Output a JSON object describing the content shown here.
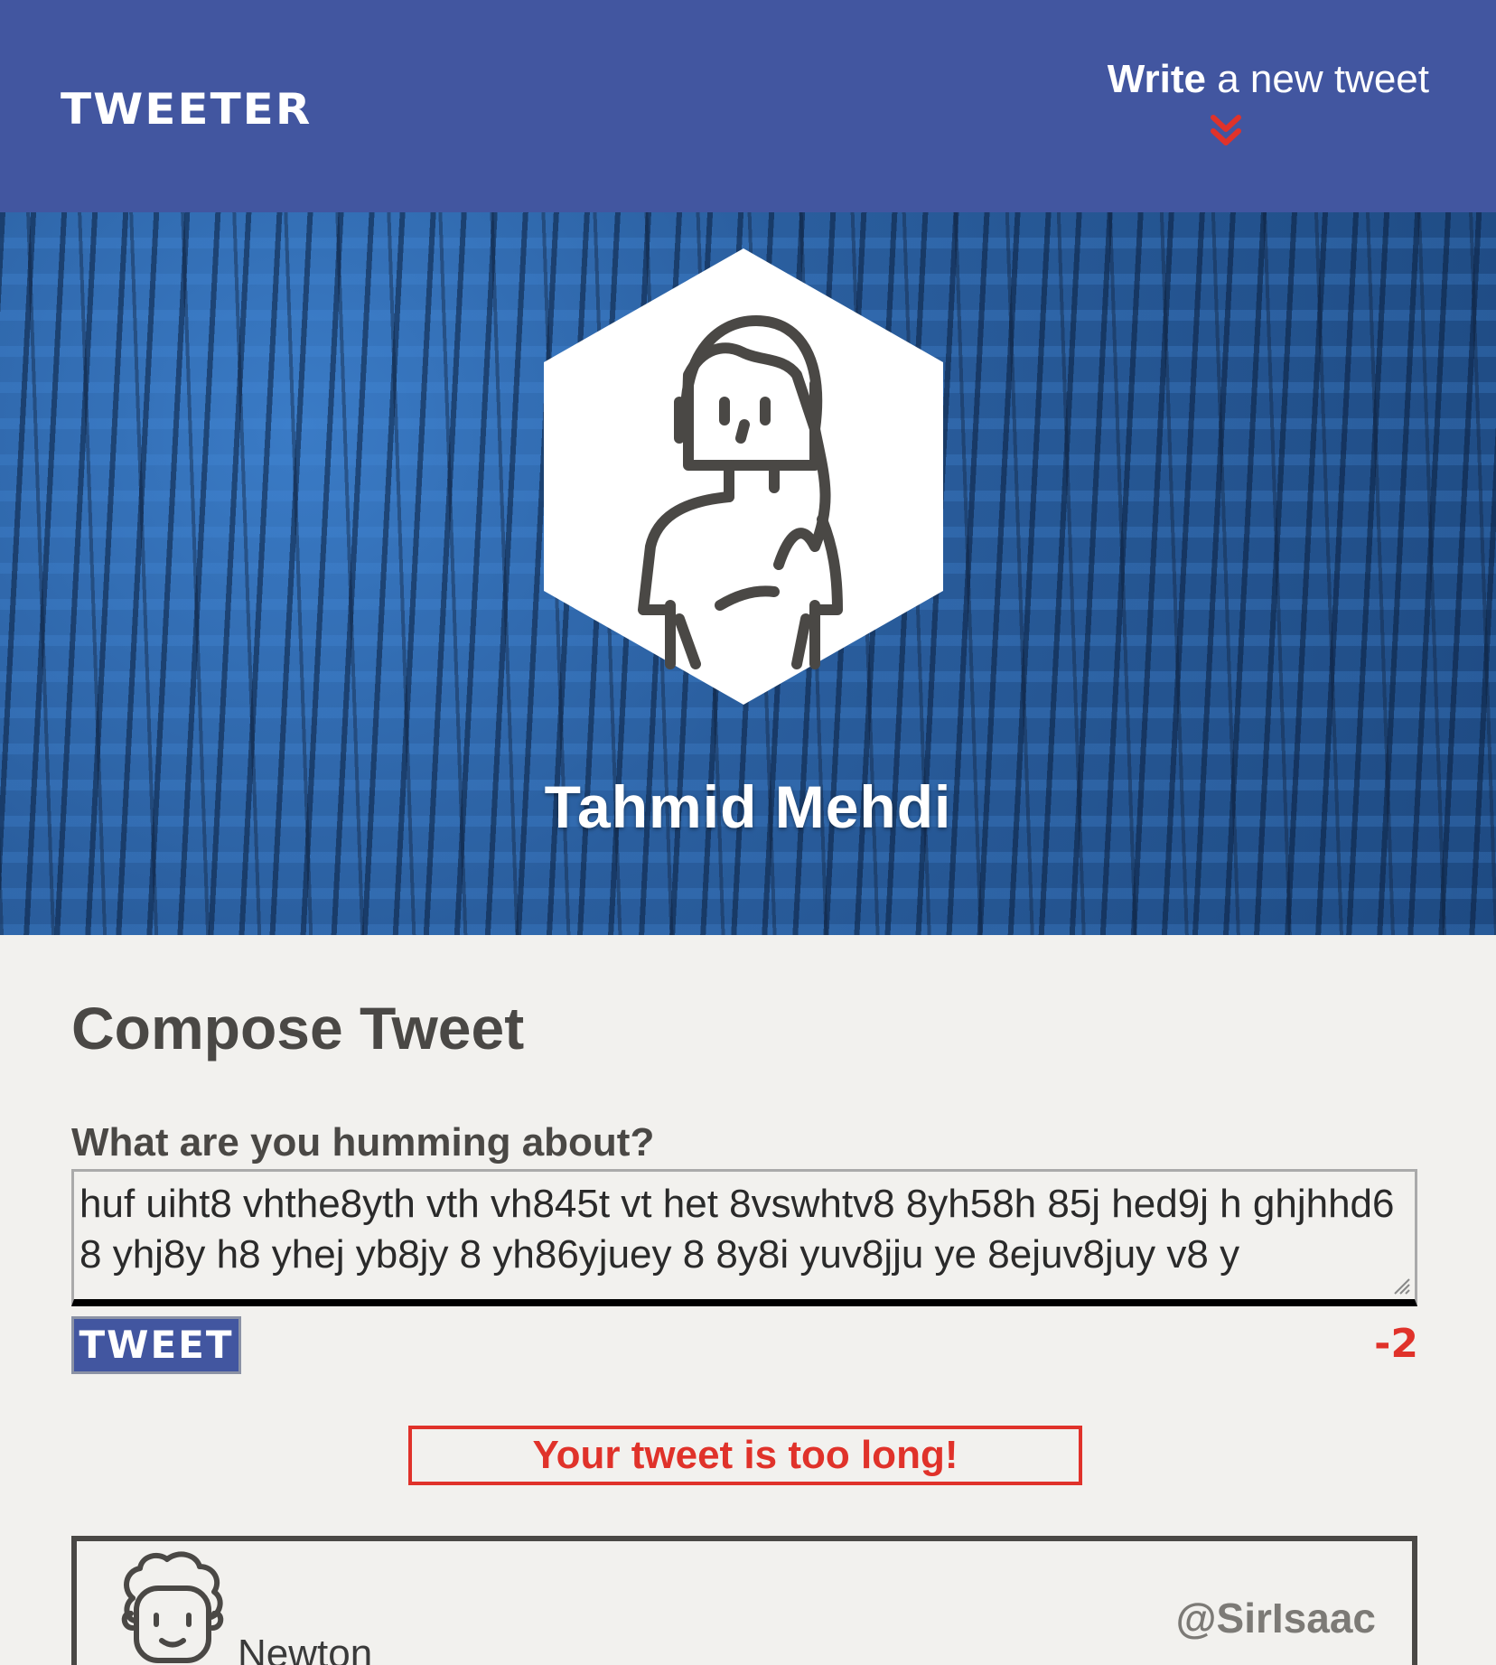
{
  "nav": {
    "brand": "TWEETER",
    "compose_toggle_bold": "Write",
    "compose_toggle_rest": " a new tweet",
    "compose_toggle_icon": "double-chevron-down-icon"
  },
  "profile": {
    "name": "Tahmid Mehdi",
    "avatar_icon": "user-avatar-icon"
  },
  "compose": {
    "title": "Compose Tweet",
    "label": "What are you humming about?",
    "text_value": "huf uiht8  vhthe8yth vth vh845t vt het 8vswhtv8 8yh58h 85j hed9j h ghjhhd68 yhj8y h8 yhej yb8jy 8 yh86yjuey 8 8y8i yuv8jju ye 8ejuv8juy  v8  y",
    "button_label": "TWEET",
    "counter": "-2",
    "error_message": "Your tweet is too long!"
  },
  "tweets": [
    {
      "name": "Newton",
      "handle": "@SirIsaac",
      "avatar_icon": "newton-avatar-icon"
    }
  ],
  "colors": {
    "nav_bg": "#4256a0",
    "page_bg": "#f2f1ee",
    "accent_red": "#e0322a",
    "text_dark": "#4a4845"
  }
}
